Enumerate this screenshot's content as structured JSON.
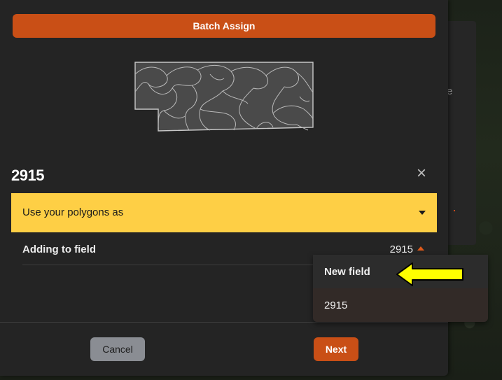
{
  "header": {
    "batch_assign_label": "Batch Assign"
  },
  "field": {
    "title": "2915",
    "close_icon": "close-icon"
  },
  "use_polygons": {
    "label": "Use your polygons as",
    "icon": "caret-down-icon"
  },
  "adding_to_field": {
    "label": "Adding to field",
    "value": "2915",
    "icon": "caret-up-icon"
  },
  "dropdown": {
    "options": [
      {
        "label": "New field"
      },
      {
        "label": "2915"
      }
    ]
  },
  "footer": {
    "cancel_label": "Cancel",
    "next_label": "Next"
  },
  "background": {
    "ghost_letter": "e"
  },
  "colors": {
    "accent": "#c94f16",
    "highlight": "#fecf45",
    "panel": "#242424",
    "annotation_arrow": "#ffff00"
  }
}
